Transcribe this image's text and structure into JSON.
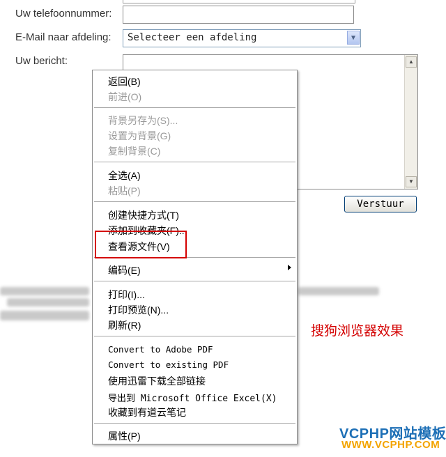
{
  "form": {
    "phone_label": "Uw telefoonnummer:",
    "phone_value": "",
    "dept_label": "E-Mail naar afdeling:",
    "dept_selected": "Selecteer een afdeling",
    "message_label": "Uw bericht:",
    "message_value": "",
    "submit_label": "Verstuur"
  },
  "context_menu": {
    "items": [
      {
        "label": "返回(B)",
        "enabled": true
      },
      {
        "label": "前进(O)",
        "enabled": false
      },
      {
        "label": "背景另存为(S)...",
        "enabled": false
      },
      {
        "label": "设置为背景(G)",
        "enabled": false
      },
      {
        "label": "复制背景(C)",
        "enabled": false
      },
      {
        "label": "全选(A)",
        "enabled": true
      },
      {
        "label": "粘贴(P)",
        "enabled": false
      },
      {
        "label": "创建快捷方式(T)",
        "enabled": true
      },
      {
        "label": "添加到收藏夹(F)...",
        "enabled": true
      },
      {
        "label": "查看源文件(V)",
        "enabled": true
      },
      {
        "label": "编码(E)",
        "enabled": true,
        "has_submenu": true
      },
      {
        "label": "打印(I)...",
        "enabled": true
      },
      {
        "label": "打印预览(N)...",
        "enabled": true
      },
      {
        "label": "刷新(R)",
        "enabled": true
      },
      {
        "label": "Convert to Adobe PDF",
        "enabled": true
      },
      {
        "label": "Convert to existing PDF",
        "enabled": true
      },
      {
        "label": "使用迅雷下载全部链接",
        "enabled": true
      },
      {
        "label": "导出到 Microsoft Office Excel(X)",
        "enabled": true
      },
      {
        "label": "收藏到有道云笔记",
        "enabled": true
      },
      {
        "label": "属性(P)",
        "enabled": true
      }
    ]
  },
  "annotation": {
    "note": "搜狗浏览器效果",
    "highlight_color": "#d40000"
  },
  "watermark": {
    "line1": "VCPHP网站模板",
    "line2": "WWW.VCPHP.COM"
  },
  "colors": {
    "select_border": "#7f9db9",
    "button_border": "#003c74",
    "watermark_blue": "#1d6fb6",
    "watermark_orange": "#f3a400"
  }
}
